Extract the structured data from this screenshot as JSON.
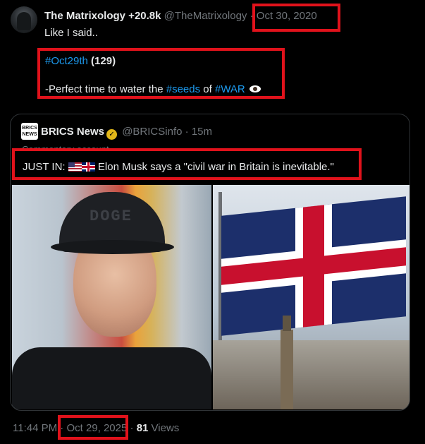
{
  "tweet": {
    "author_name": "The Matrixology +20.8k",
    "handle": "@TheMatrixology",
    "separator": "·",
    "date": "Oct 30, 2020",
    "line1": "Like I said..",
    "hashtag_oct": "#Oct29th",
    "count": "(129)",
    "perfect_prefix": "-Perfect time to water the",
    "hashtag_seeds": "#seeds",
    "of_text": "of",
    "hashtag_war": "#WAR"
  },
  "quote": {
    "logo_text": "BRICS NEWS",
    "name": "BRICS News",
    "handle": "@BRICSinfo",
    "separator": "·",
    "time": "15m",
    "commentary_label": "Commentary account",
    "text_prefix": "JUST IN:",
    "text_body": "Elon Musk says a \"civil war in Britain is inevitable.\"",
    "cap_text": "DOGE"
  },
  "footer": {
    "time": "11:44 PM",
    "separator": "·",
    "date": "Oct 29, 2025",
    "views_count": "81",
    "views_label": "Views"
  },
  "colors": {
    "background": "#000000",
    "link": "#1d9bf0",
    "muted": "#71767b",
    "highlight_box": "#e0121b"
  }
}
